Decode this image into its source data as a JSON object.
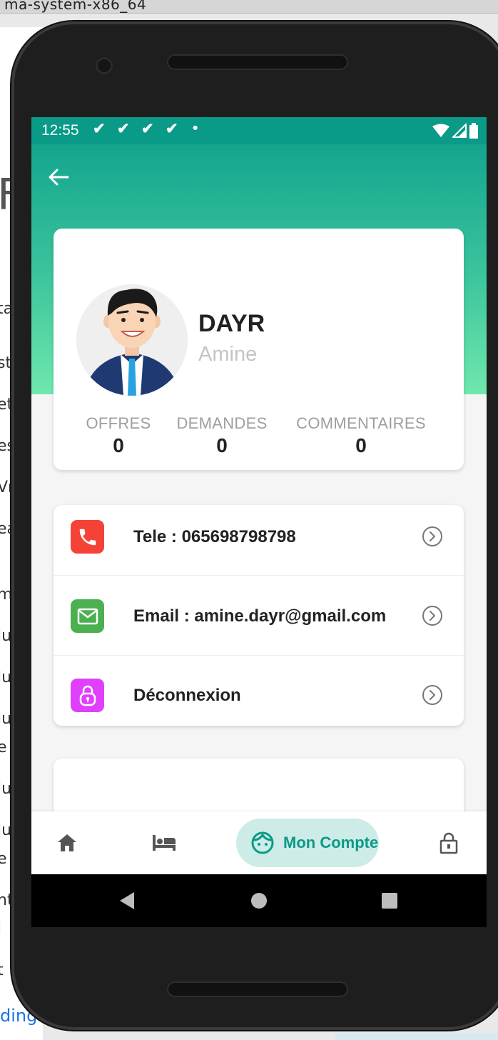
{
  "background": {
    "window_title": "ma-system-x86_64",
    "fragments": [
      "F",
      "ta",
      "st",
      "et",
      "es",
      "Vr",
      "ea",
      "m",
      "lu",
      "lu",
      "lu",
      "e",
      "lu",
      "lu",
      "e",
      "nt",
      "l",
      "t"
    ],
    "loading_text": "ding"
  },
  "status_bar": {
    "time": "12:55",
    "notifications": [
      "✔",
      "✔",
      "✔",
      "✔",
      "•"
    ]
  },
  "profile": {
    "last_name": "DAYR",
    "first_name": "Amine",
    "stats": [
      {
        "label": "OFFRES",
        "value": "0"
      },
      {
        "label": "DEMANDES",
        "value": "0"
      },
      {
        "label": "COMMENTAIRES",
        "value": "0"
      }
    ]
  },
  "menu": [
    {
      "icon": "phone-icon",
      "color": "#f44336",
      "label": "Tele : 065698798798"
    },
    {
      "icon": "email-icon",
      "color": "#4caf50",
      "label": "Email : amine.dayr@gmail.com"
    },
    {
      "icon": "lock-icon",
      "color": "#e040fb",
      "label": "Déconnexion"
    }
  ],
  "bottom_nav": {
    "items": [
      "home-icon",
      "hotel-bed-icon",
      "account-face-icon",
      "lock-open-icon"
    ],
    "active_label": "Mon Compte",
    "active_color": "#0b9a87"
  },
  "colors": {
    "status_bar": "#0a9a88",
    "header_gradient_top": "#14a58f",
    "header_gradient_bottom": "#6fe8ad"
  }
}
